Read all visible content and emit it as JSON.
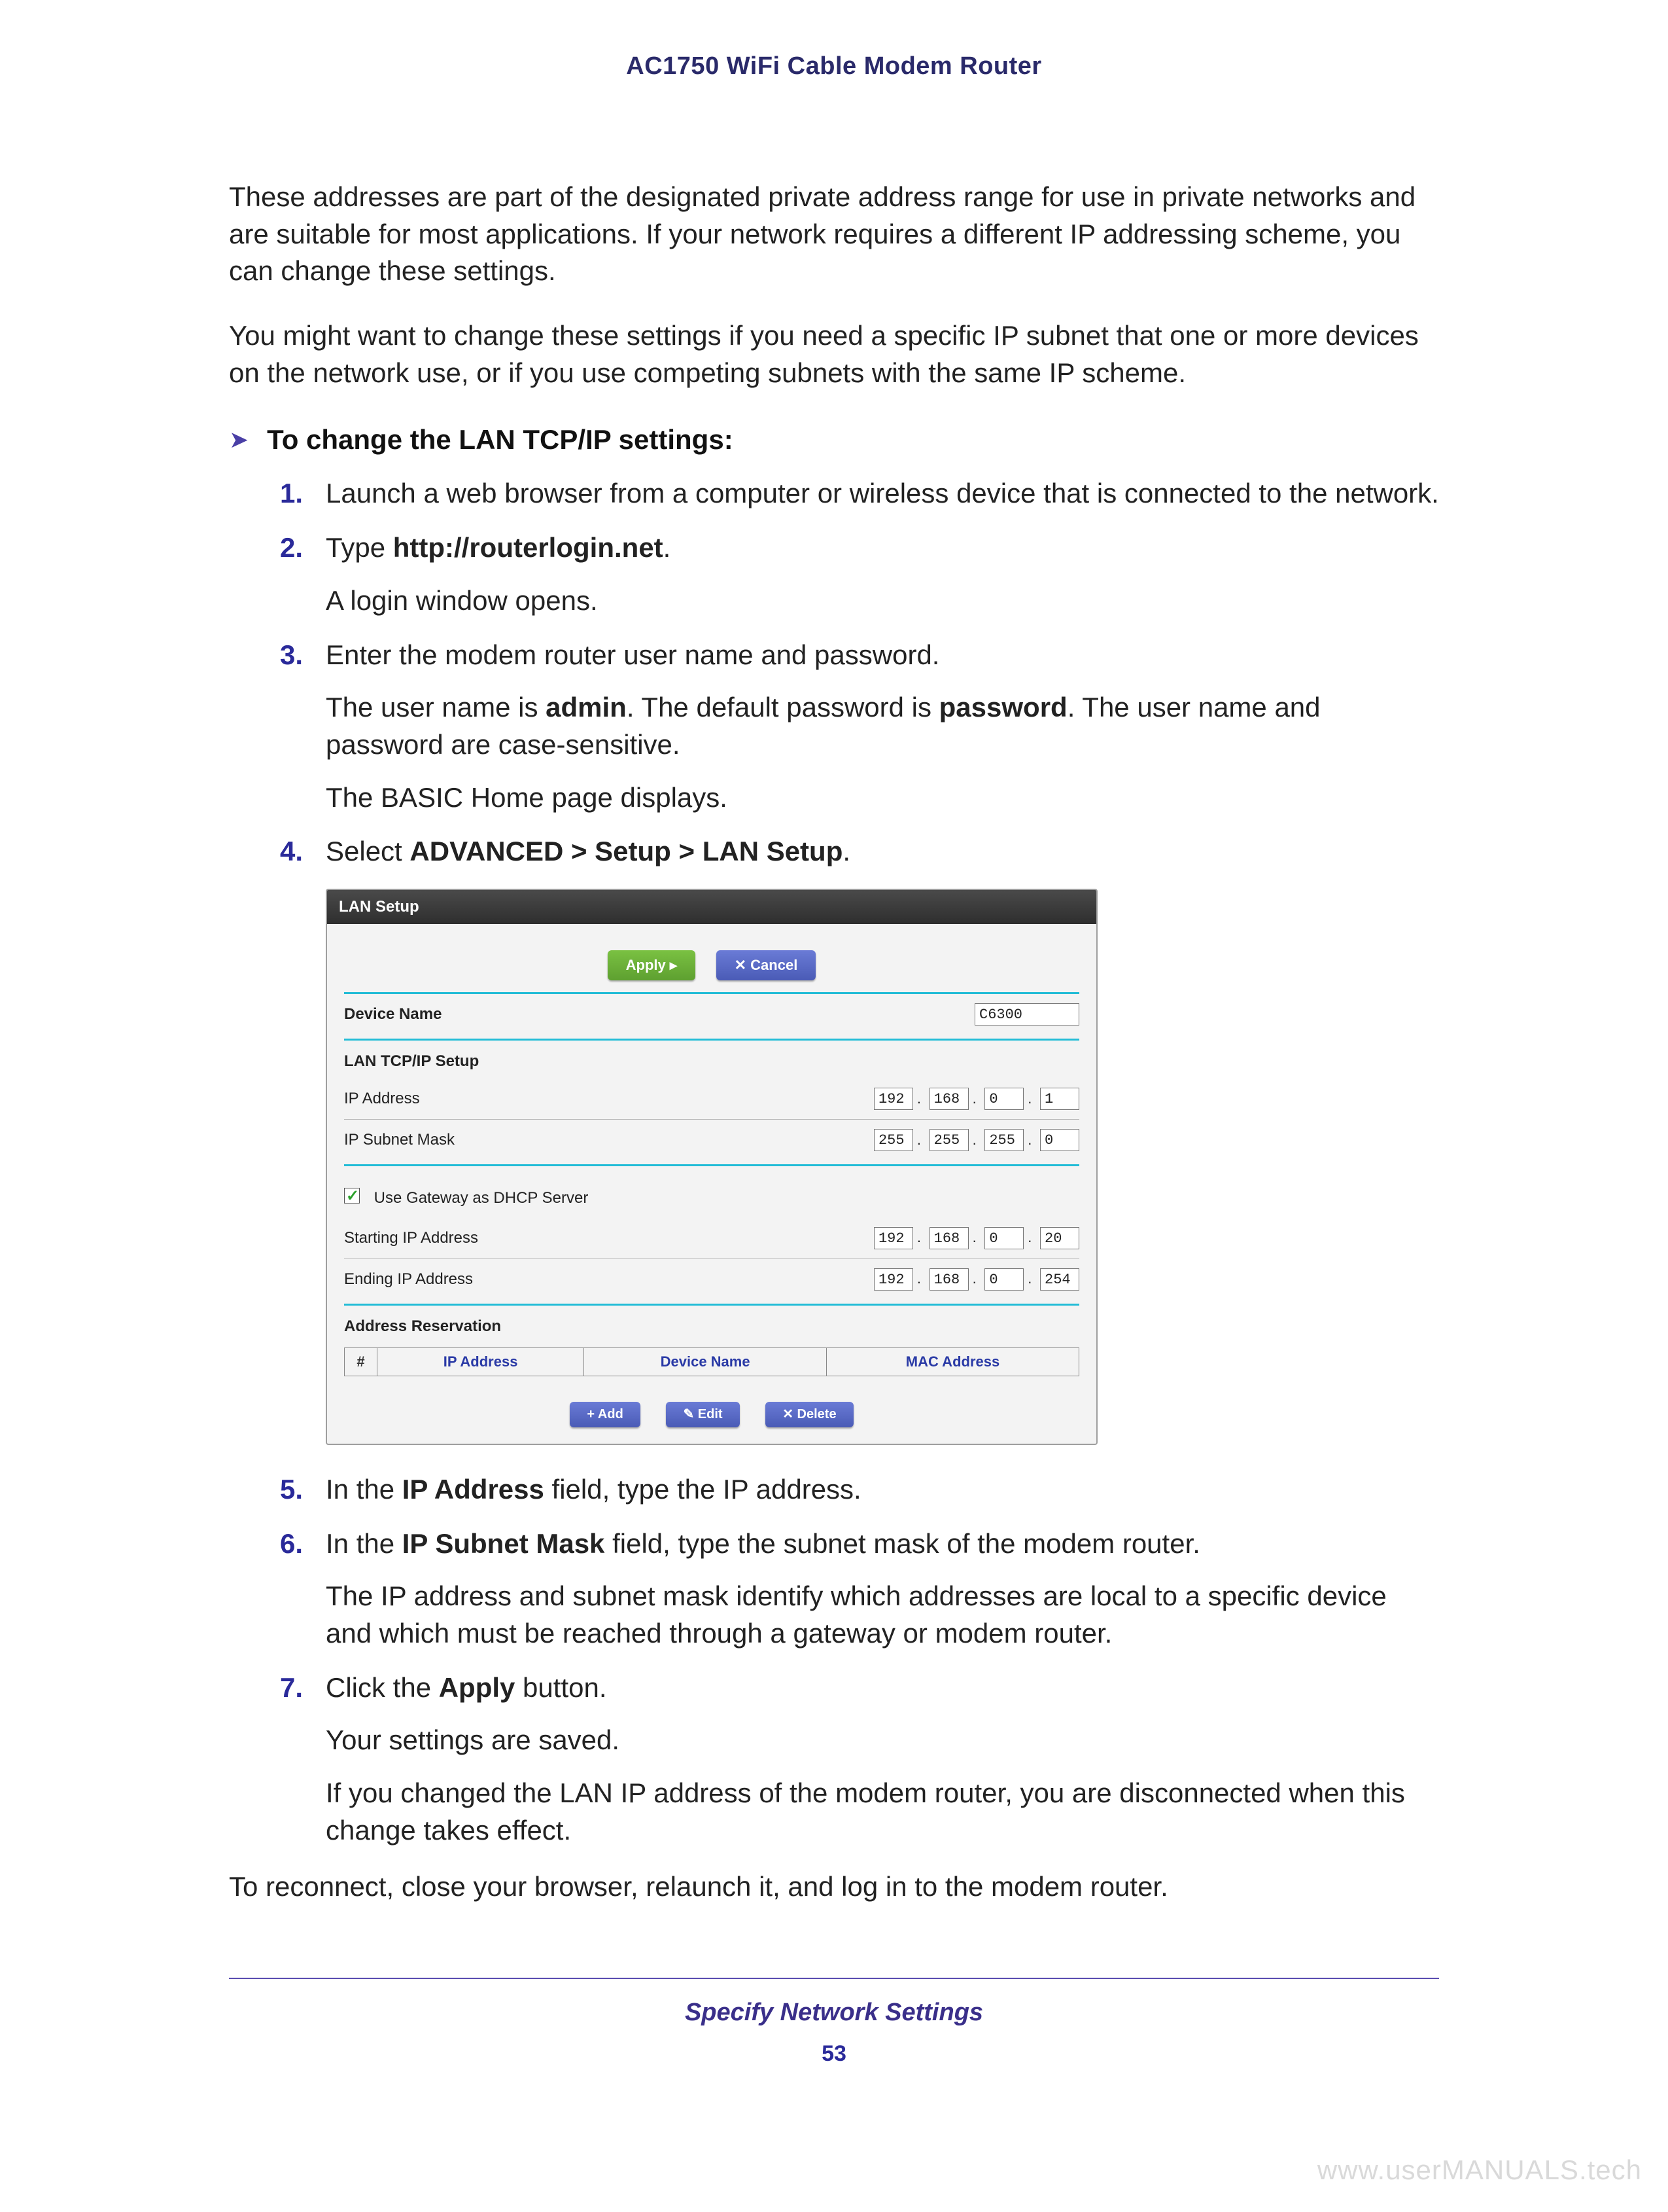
{
  "header": {
    "title": "AC1750 WiFi Cable Modem Router"
  },
  "intro": {
    "p1": "These addresses are part of the designated private address range for use in private networks and are suitable for most applications. If your network requires a different IP addressing scheme, you can change these settings.",
    "p2": "You might want to change these settings if you need a specific IP subnet that one or more devices on the network use, or if you use competing subnets with the same IP scheme."
  },
  "section": {
    "arrow": "➤",
    "title": "To change the LAN TCP/IP settings:"
  },
  "steps": {
    "s1": "Launch a web browser from a computer or wireless device that is connected to the network.",
    "s2_pre": "Type ",
    "s2_bold": "http://routerlogin.net",
    "s2_post": ".",
    "s2_sub": "A login window opens.",
    "s3": "Enter the modem router user name and password.",
    "s3_sub_a": "The user name is ",
    "s3_sub_admin": "admin",
    "s3_sub_b": ". The default password is ",
    "s3_sub_pw": "password",
    "s3_sub_c": ". The user name and password are case-sensitive.",
    "s3_sub2": "The BASIC Home page displays.",
    "s4_pre": "Select ",
    "s4_bold": "ADVANCED > Setup > LAN Setup",
    "s4_post": ".",
    "s5_pre": "In the ",
    "s5_bold": "IP Address",
    "s5_post": " field, type the IP address.",
    "s6_pre": "In the ",
    "s6_bold": "IP Subnet Mask",
    "s6_post": " field, type the subnet mask of the modem router.",
    "s6_sub": "The IP address and subnet mask identify which addresses are local to a specific device and which must be reached through a gateway or modem router.",
    "s7_pre": "Click the ",
    "s7_bold": "Apply",
    "s7_post": " button.",
    "s7_sub1": "Your settings are saved.",
    "s7_sub2": "If you changed the LAN IP address of the modem router, you are disconnected when this change takes effect."
  },
  "closing": "To reconnect, close your browser, relaunch it, and log in to the modem router.",
  "panel": {
    "title": "LAN Setup",
    "apply": "Apply ▸",
    "cancel": "✕ Cancel",
    "device_name_label": "Device Name",
    "device_name_value": "C6300",
    "tcp_header": "LAN TCP/IP Setup",
    "ip_label": "IP Address",
    "ip": [
      "192",
      "168",
      "0",
      "1"
    ],
    "mask_label": "IP Subnet Mask",
    "mask": [
      "255",
      "255",
      "255",
      "0"
    ],
    "dhcp_check": "Use Gateway as DHCP Server",
    "start_label": "Starting IP Address",
    "start": [
      "192",
      "168",
      "0",
      "20"
    ],
    "end_label": "Ending IP Address",
    "end": [
      "192",
      "168",
      "0",
      "254"
    ],
    "res_header": "Address Reservation",
    "th_hash": "#",
    "th_ip": "IP Address",
    "th_dev": "Device Name",
    "th_mac": "MAC Address",
    "add": "+ Add",
    "edit": "✎ Edit",
    "delete": "✕ Delete"
  },
  "footer": {
    "section": "Specify Network Settings",
    "page": "53",
    "watermark": "www.userMANUALS.tech"
  }
}
